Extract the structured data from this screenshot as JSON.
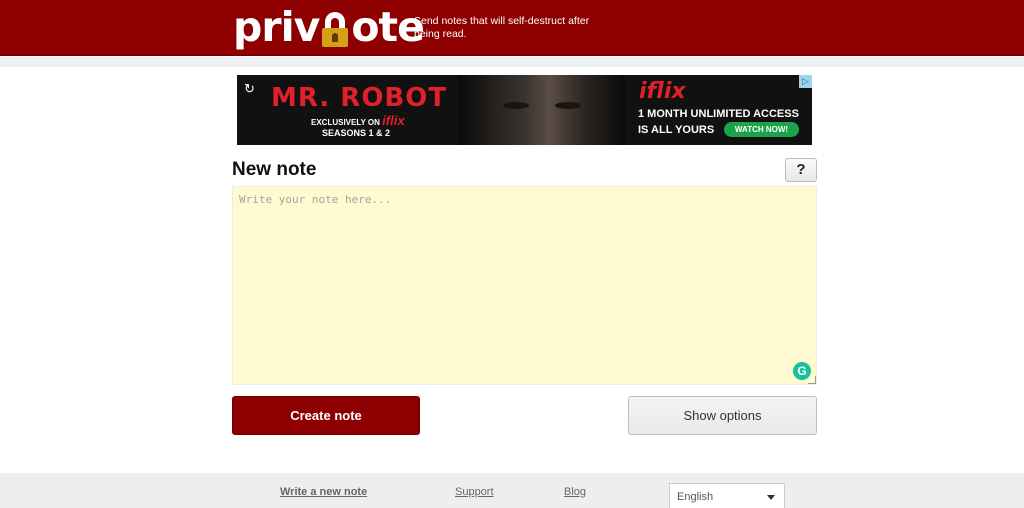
{
  "header": {
    "logo_text_left": "priv",
    "logo_text_right": "ote",
    "tagline": "Send notes that will self-destruct after being read."
  },
  "ad": {
    "title": "MR. ROBOT",
    "exclusive_prefix": "EXCLUSIVELY ON",
    "exclusive_brand": "iflix",
    "seasons": "SEASONS 1 & 2",
    "brand": "iflix",
    "offer_line1": "1 MONTH UNLIMITED ACCESS",
    "offer_line2": "IS ALL YOURS",
    "cta": "WATCH NOW!",
    "refresh_icon": "refresh-icon",
    "adchoices_icon": "adchoices-icon"
  },
  "form": {
    "heading": "New note",
    "help_label": "?",
    "note_placeholder": "Write your note here...",
    "note_value": "",
    "create_label": "Create note",
    "options_label": "Show options",
    "grammarly_label": "G"
  },
  "footer": {
    "links": [
      "Write a new note",
      "Support",
      "Blog"
    ],
    "language": "English"
  },
  "colors": {
    "brand": "#8e0000",
    "note_background": "#fffad0",
    "footer_background": "#eeeeee"
  }
}
